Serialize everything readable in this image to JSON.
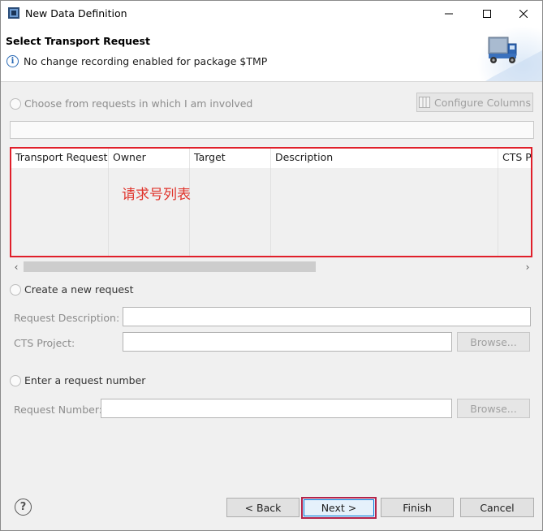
{
  "window": {
    "title": "New Data Definition",
    "controls": {
      "minimize": "—",
      "maximize": "☐",
      "close": "✕"
    }
  },
  "header": {
    "title": "Select Transport Request",
    "info_message": "No change recording enabled for package $TMP",
    "info_icon": "i"
  },
  "choose_section": {
    "radio_label": "Choose from requests in which I am involved",
    "configure_columns_label": "Configure Columns",
    "filter_value": "",
    "table": {
      "columns": [
        "Transport Request",
        "Owner",
        "Target",
        "Description",
        "CTS Pro"
      ],
      "rows": []
    },
    "annotation": "请求号列表"
  },
  "create_section": {
    "radio_label": "Create a new request",
    "request_description_label": "Request Description:",
    "required_mark": "*",
    "request_description_value": "",
    "cts_project_label": "CTS Project:",
    "cts_project_value": "",
    "browse_label": "Browse..."
  },
  "enter_section": {
    "radio_label": "Enter a request number",
    "request_number_label": "Request Number:",
    "request_number_value": "",
    "browse_label": "Browse..."
  },
  "footer": {
    "help_icon": "?",
    "back_label": "< Back",
    "next_label": "Next >",
    "finish_label": "Finish",
    "cancel_label": "Cancel"
  },
  "colors": {
    "highlight_border": "#e01f2a",
    "annotation_text": "#e0342c",
    "next_highlight": "#b4234a"
  }
}
